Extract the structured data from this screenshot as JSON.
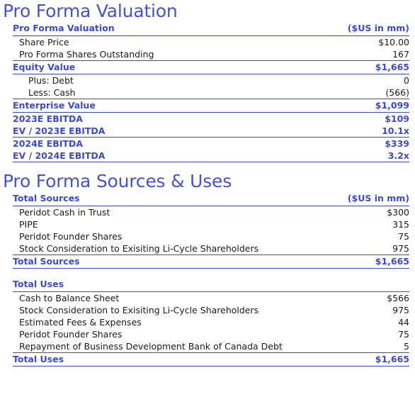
{
  "colors": {
    "accent_blue": "#3b49d4",
    "heading_blue": "#4650d8",
    "body_text": "#1b1b1b",
    "background": "#ffffff"
  },
  "sections": [
    {
      "heading": "Pro Forma Valuation",
      "table": {
        "header_label": "Pro Forma Valuation",
        "header_units": "($US in mm)",
        "rows": [
          {
            "label": "Share Price",
            "value": "$10.00"
          },
          {
            "label": "Pro Forma Shares Outstanding",
            "value": "167"
          },
          {
            "label": "Equity Value",
            "value": "$1,665"
          },
          {
            "label": "Plus: Debt",
            "value": "0"
          },
          {
            "label": "Less: Cash",
            "value": "(566)"
          },
          {
            "label": "Enterprise Value",
            "value": "$1,099"
          },
          {
            "label": "2023E EBITDA",
            "value": "$109"
          },
          {
            "label": "EV / 2023E EBITDA",
            "value": "10.1x"
          },
          {
            "label": "2024E EBITDA",
            "value": "$339"
          },
          {
            "label": "EV / 2024E EBITDA",
            "value": "3.2x"
          }
        ]
      }
    },
    {
      "heading": "Pro Forma Sources & Uses",
      "sources": {
        "header_label": "Total Sources",
        "header_units": "($US in mm)",
        "rows": [
          {
            "label": "Peridot Cash in Trust",
            "value": "$300"
          },
          {
            "label": "PIPE",
            "value": "315"
          },
          {
            "label": "Peridot Founder Shares",
            "value": "75"
          },
          {
            "label": "Stock Consideration to Exisiting Li-Cycle Shareholders",
            "value": "975"
          }
        ],
        "total_label": "Total Sources",
        "total_value": "$1,665"
      },
      "uses": {
        "header_label": "Total Uses",
        "rows": [
          {
            "label": "Cash to Balance Sheet",
            "value": "$566"
          },
          {
            "label": "Stock Consideration to Exisiting Li-Cycle Shareholders",
            "value": "975"
          },
          {
            "label": "Estimated Fees & Expenses",
            "value": "44"
          },
          {
            "label": "Peridot Founder Shares",
            "value": "75"
          },
          {
            "label": "Repayment of Business Development Bank of Canada Debt",
            "value": "5"
          }
        ],
        "total_label": "Total Uses",
        "total_value": "$1,665"
      }
    }
  ]
}
